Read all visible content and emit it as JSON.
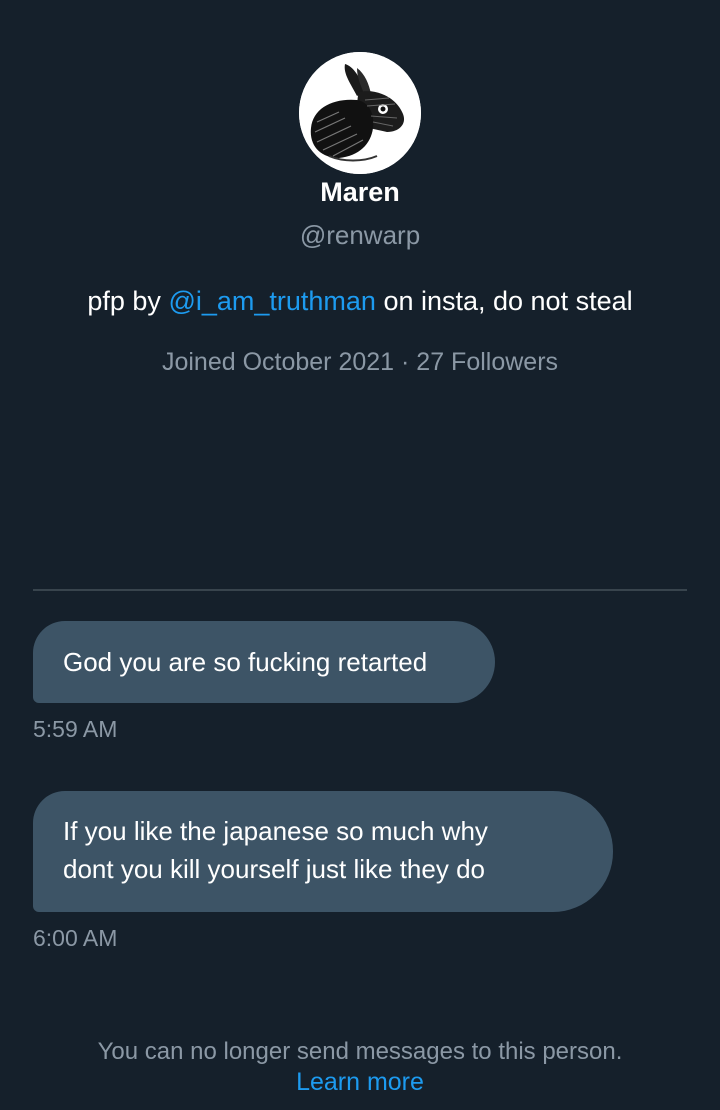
{
  "profile": {
    "avatar_icon": "rabbit-sketch-avatar",
    "display_name": "Maren",
    "handle": "@renwarp",
    "bio": {
      "prefix": "pfp by ",
      "mention": "@i_am_truthman",
      "suffix": " on insta, do not steal"
    },
    "joined": "Joined October 2021",
    "separator": " · ",
    "followers": "27 Followers"
  },
  "messages": [
    {
      "text": "God you are so fucking retarted",
      "time": "5:59 AM"
    },
    {
      "line1": "If you like the japanese so much why",
      "line2": "dont you kill yourself just like they do",
      "time": "6:00 AM"
    }
  ],
  "footer": {
    "notice": "You can no longer send messages to this person.",
    "link": "Learn more"
  },
  "colors": {
    "background": "#15202b",
    "bubble": "#3d5466",
    "accent": "#1d9bf0",
    "muted": "#8b98a5"
  }
}
